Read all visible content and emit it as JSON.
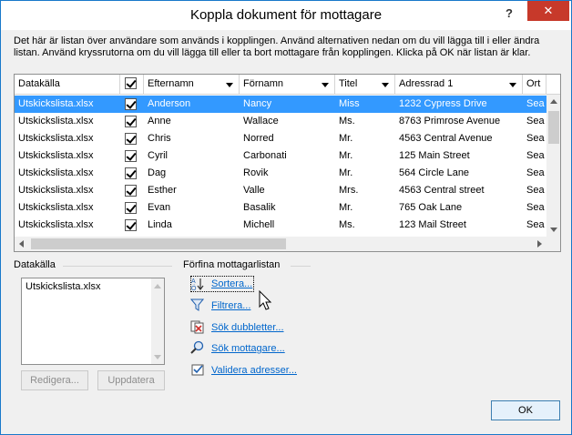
{
  "window": {
    "title": "Koppla dokument för mottagare",
    "help": "?",
    "close": "✕"
  },
  "intro": "Det här är listan över användare som används i kopplingen. Använd alternativen nedan om du vill lägga till i eller ändra listan. Använd kryssrutorna om du vill lägga till eller ta bort mottagare från kopplingen. Klicka på OK när listan är klar.",
  "grid": {
    "columns": [
      "Datakälla",
      "",
      "Efternamn",
      "Förnamn",
      "Titel",
      "Adressrad 1",
      "Ort"
    ],
    "rows": [
      {
        "source": "Utskickslista.xlsx",
        "last": "Anderson",
        "first": "Nancy",
        "title": "Miss",
        "addr": "1232 Cypress Drive",
        "city": "Sea",
        "selected": true
      },
      {
        "source": "Utskickslista.xlsx",
        "last": "Anne",
        "first": "Wallace",
        "title": "Ms.",
        "addr": "8763 Primrose Avenue",
        "city": "Sea",
        "selected": false
      },
      {
        "source": "Utskickslista.xlsx",
        "last": "Chris",
        "first": "Norred",
        "title": "Mr.",
        "addr": "4563 Central Avenue",
        "city": "Sea",
        "selected": false
      },
      {
        "source": "Utskickslista.xlsx",
        "last": "Cyril",
        "first": "Carbonati",
        "title": "Mr.",
        "addr": "125 Main Street",
        "city": "Sea",
        "selected": false
      },
      {
        "source": "Utskickslista.xlsx",
        "last": "Dag",
        "first": "Rovik",
        "title": "Mr.",
        "addr": "564 Circle Lane",
        "city": "Sea",
        "selected": false
      },
      {
        "source": "Utskickslista.xlsx",
        "last": "Esther",
        "first": "Valle",
        "title": "Mrs.",
        "addr": "4563 Central street",
        "city": "Sea",
        "selected": false
      },
      {
        "source": "Utskickslista.xlsx",
        "last": "Evan",
        "first": "Basalik",
        "title": "Mr.",
        "addr": "765 Oak Lane",
        "city": "Sea",
        "selected": false
      },
      {
        "source": "Utskickslista.xlsx",
        "last": "Linda",
        "first": "Michell",
        "title": "Ms.",
        "addr": "123 Mail Street",
        "city": "Sea",
        "selected": false
      }
    ]
  },
  "datasource": {
    "label": "Datakälla",
    "item": "Utskickslista.xlsx",
    "edit": "Redigera...",
    "update": "Uppdatera"
  },
  "refine": {
    "label": "Förfina mottagarlistan",
    "sort": "Sortera...",
    "filter": "Filtrera...",
    "dupes": "Sök dubbletter...",
    "find": "Sök mottagare...",
    "validate": "Validera adresser..."
  },
  "ok": "OK"
}
